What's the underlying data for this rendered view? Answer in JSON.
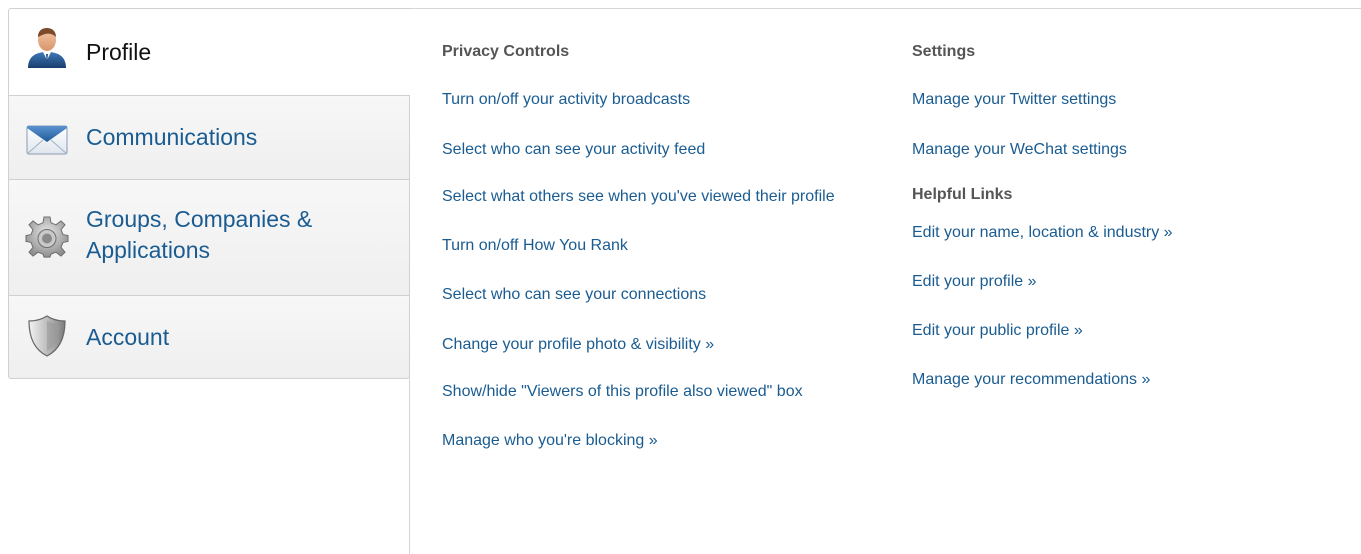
{
  "sidebar": {
    "tabs": [
      {
        "label": "Profile",
        "icon": "user-icon",
        "active": true
      },
      {
        "label": "Communications",
        "icon": "envelope-icon",
        "active": false
      },
      {
        "label": "Groups, Companies & Applications",
        "icon": "gear-icon",
        "active": false
      },
      {
        "label": "Account",
        "icon": "shield-icon",
        "active": false
      }
    ]
  },
  "privacy": {
    "heading": "Privacy Controls",
    "links": [
      "Turn on/off your activity broadcasts",
      "Select who can see your activity feed",
      "Select what others see when you've viewed their profile",
      "Turn on/off How You Rank",
      "Select who can see your connections",
      "Change your profile photo & visibility »",
      "Show/hide \"Viewers of this profile also viewed\" box",
      "Manage who you're blocking »"
    ]
  },
  "settings": {
    "heading": "Settings",
    "links": [
      "Manage your Twitter settings",
      "Manage your WeChat settings"
    ]
  },
  "helpful": {
    "heading": "Helpful Links",
    "links": [
      "Edit your name, location & industry »",
      "Edit your profile »",
      "Edit your public profile »",
      "Manage your recommendations »"
    ]
  },
  "colors": {
    "link": "#1a5c91",
    "heading": "#555555",
    "border": "#d0d0d0"
  }
}
